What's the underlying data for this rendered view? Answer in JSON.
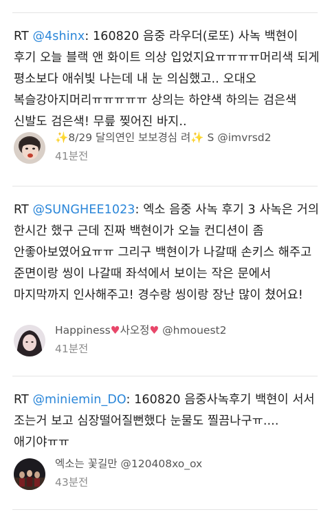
{
  "tweets": [
    {
      "rt": "RT ",
      "mention": "@4shinx",
      "body": ": 160820 음중 라우더(로또) 사녹 백현이 후기 오늘 블랙 앤 화이트 의상 입었지요ㅠㅠㅠㅠ머리색 되게 평소보다 애쉬빛 나는데 내 눈 의심했고.. 오대오 복슬강아지머리ㅠㅠㅠㅠㅠ 상의는 하얀색 하의는 검은색 신발도 검은색! 무릎 찢어진 바지..",
      "author": {
        "spark_left": "✨",
        "name_main": "8/29 달의연인 보보경심 려",
        "spark_right": "✨",
        "handle": " S @imvrsd2"
      },
      "time": "41분전"
    },
    {
      "rt": "RT ",
      "mention": "@SUNGHEE1023",
      "body": ": 엑소 음중 사녹 후기 3 사녹은 거의 한시간 했구 근데 진짜 백현이가 오늘 컨디션이 좀 안좋아보였어요ㅠㅠ 그리구 백현이가 나갈때 손키스 해주고 준면이랑 씽이 나갈때 좌석에서 보이는 작은 문에서 마지막까지 인사해주고! 경수랑 씽이랑 장난 많이 쳤어요!",
      "author": {
        "name_a": "Happiness",
        "heart_a": "♥",
        "name_b": "사오정",
        "heart_b": "♥",
        "handle": " @hmouest2"
      },
      "time": "41분전"
    },
    {
      "rt": "RT ",
      "mention": "@miniemin_DO",
      "body": ": 160820 음중사녹후기 백현이 서서 조는거 보고 심장떨어질뻔했다 눈물도 찔끔나구ㅠ....애기야ㅠㅠ",
      "author": {
        "name": "엑소는 꽃길만",
        "handle": " @120408xo_ox"
      },
      "time": "43분전"
    }
  ]
}
